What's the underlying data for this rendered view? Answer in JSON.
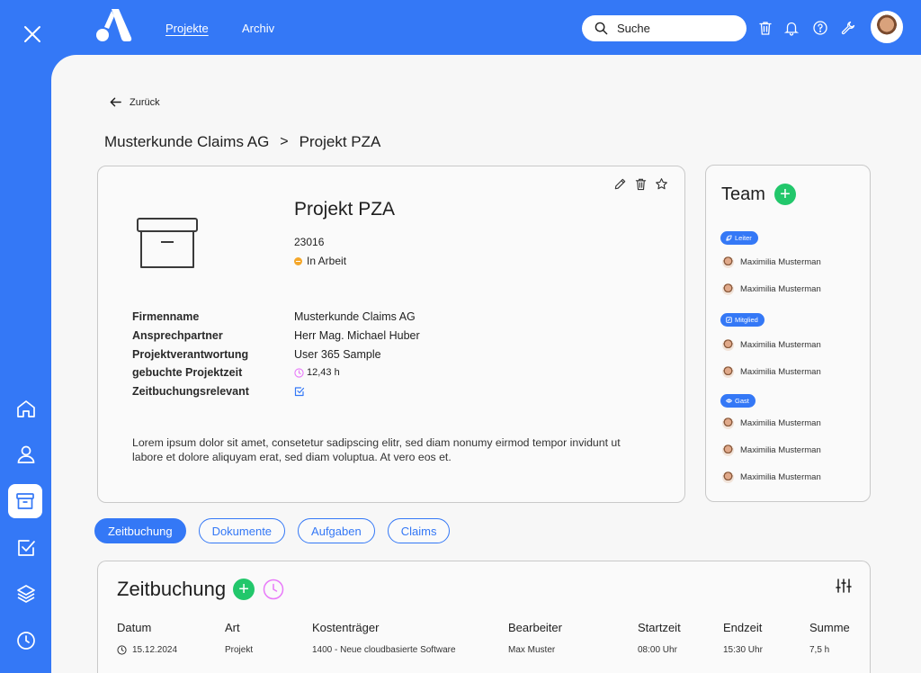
{
  "colors": {
    "primary": "#3478f6",
    "green": "#22c76b",
    "pink": "#e879f9",
    "status_orange": "#f4a72a"
  },
  "nav": {
    "links": [
      "Projekte",
      "Archiv"
    ],
    "active": "Projekte"
  },
  "search": {
    "placeholder": "Suche"
  },
  "icons": {
    "top": [
      "trash-icon",
      "bell-icon",
      "help-icon",
      "wrench-icon"
    ],
    "sidebar": [
      "home-icon",
      "user-icon",
      "archive-icon",
      "checkbox-icon",
      "layers-icon",
      "clock-icon"
    ]
  },
  "back_label": "Zurück",
  "breadcrumb": {
    "parent": "Musterkunde Claims AG",
    "separator": ">",
    "current": "Projekt PZA"
  },
  "project": {
    "title": "Projekt PZA",
    "number": "23016",
    "status": "In Arbeit",
    "fields": [
      {
        "label": "Firmenname",
        "value": "Musterkunde Claims AG"
      },
      {
        "label": "Ansprechpartner",
        "value": "Herr Mag. Michael Huber"
      },
      {
        "label": "Projektverantwortung",
        "value": "User 365 Sample"
      },
      {
        "label": "gebuchte Projektzeit",
        "value": "12,43 h"
      },
      {
        "label": "Zeitbuchungsrelevant",
        "value": ""
      }
    ],
    "description": "Lorem ipsum dolor sit amet, consetetur sadipscing elitr, sed diam nonumy eirmod tempor invidunt ut labore et dolore  aliquyam erat, sed diam voluptua. At vero eos et."
  },
  "team": {
    "title": "Team",
    "groups": [
      {
        "role": "Leiter",
        "members": [
          "Maximilia Musterman",
          "Maximilia Musterman"
        ]
      },
      {
        "role": "Mitglied",
        "members": [
          "Maximilia Musterman",
          "Maximilia Musterman"
        ]
      },
      {
        "role": "Gast",
        "members": [
          "Maximilia Musterman",
          "Maximilia Musterman",
          "Maximilia Musterman"
        ]
      }
    ]
  },
  "tabs": [
    "Zeitbuchung",
    "Dokumente",
    "Aufgaben",
    "Claims"
  ],
  "active_tab": "Zeitbuchung",
  "zeitbuchung": {
    "title": "Zeitbuchung",
    "columns": [
      "Datum",
      "Art",
      "Kostenträger",
      "Bearbeiter",
      "Startzeit",
      "Endzeit",
      "Summe"
    ],
    "rows": [
      [
        "15.12.2024",
        "Projekt",
        "1400 - Neue cloudbasierte Software",
        "Max Muster",
        "08:00 Uhr",
        "15:30 Uhr",
        "7,5 h"
      ]
    ]
  }
}
